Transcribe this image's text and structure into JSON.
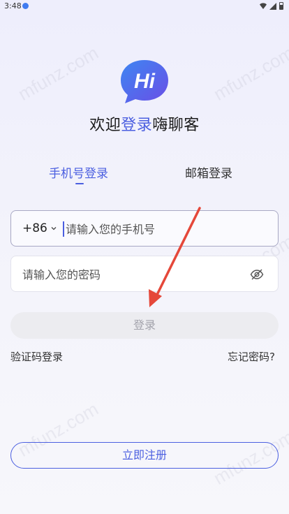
{
  "status_bar": {
    "time": "3:48"
  },
  "welcome": {
    "prefix": "欢迎",
    "highlight": "登录",
    "suffix": "嗨聊客"
  },
  "logo": {
    "text": "Hi"
  },
  "tabs": [
    {
      "label": "手机号登录",
      "active": true
    },
    {
      "label": "邮箱登录",
      "active": false
    }
  ],
  "phone": {
    "country_code": "+86",
    "placeholder": "请输入您的手机号",
    "value": ""
  },
  "password": {
    "placeholder": "请输入您的密码",
    "value": ""
  },
  "login_button": {
    "label": "登录"
  },
  "links": {
    "sms_login": "验证码登录",
    "forgot_password": "忘记密码?"
  },
  "register_button": {
    "label": "立即注册"
  },
  "watermark": {
    "text": "mfunz.com"
  },
  "colors": {
    "accent": "#4b5fe0",
    "arrow": "#e5483a"
  },
  "icons": [
    "wifi-icon",
    "signal-icon",
    "battery-icon",
    "chevron-down-icon",
    "eye-off-icon"
  ]
}
